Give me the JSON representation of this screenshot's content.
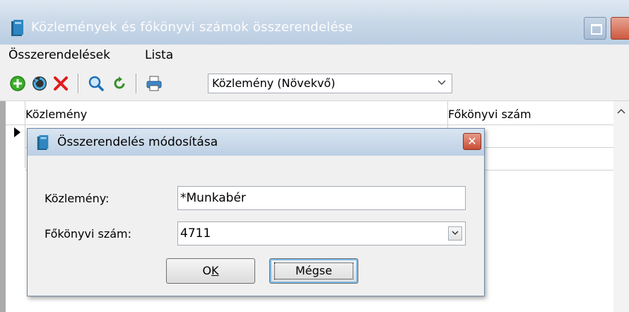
{
  "window": {
    "title": "Közlemények és főkönyvi számok összerendelése",
    "icon": "app-book-icon"
  },
  "menu": {
    "items": [
      "Összerendelések",
      "Lista"
    ]
  },
  "toolbar": {
    "icons": [
      "add-icon",
      "refresh-icon",
      "delete-icon",
      "search-icon",
      "reload-icon",
      "print-icon"
    ],
    "sort_value": "Közlemény (Növekvő)"
  },
  "grid": {
    "columns": [
      "Közlemény",
      "Főkönyvi szám"
    ]
  },
  "dialog": {
    "title": "Összerendelés módosítása",
    "fields": {
      "kozlemeny_label": "Közlemény:",
      "kozlemeny_value": "*Munkabér",
      "fokonyvi_label": "Főkönyvi szám:",
      "fokonyvi_value": "4711"
    },
    "buttons": {
      "ok_prefix": "O",
      "ok_underlined": "K",
      "cancel": "Mégse"
    }
  },
  "colors": {
    "add": "#3dae2b",
    "delete": "#e21b1b",
    "accent": "#1e6fb8"
  }
}
